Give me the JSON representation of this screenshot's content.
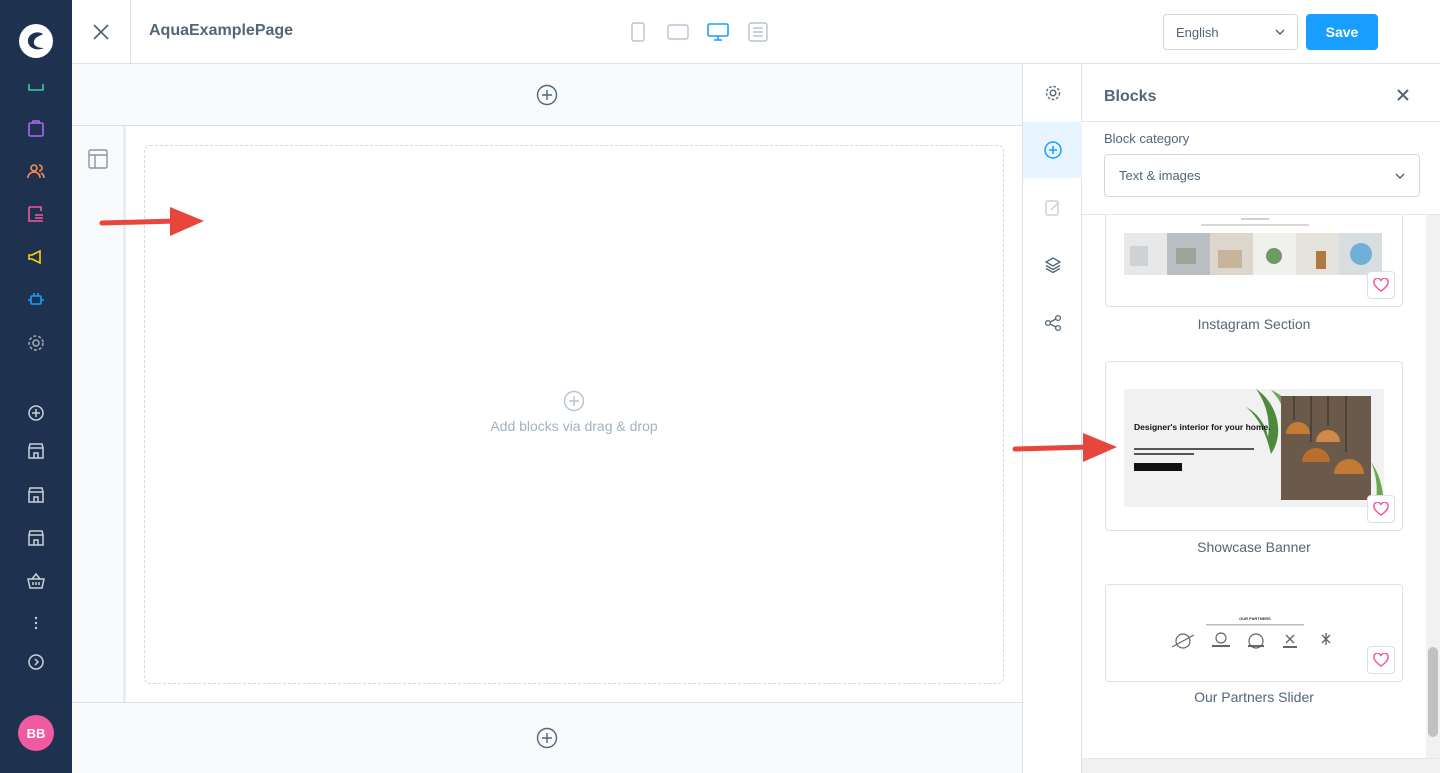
{
  "app": {
    "avatar_initials": "BB",
    "nav_icons": [
      "dashboard-icon",
      "catalog-icon",
      "customers-icon",
      "orders-icon",
      "marketing-icon",
      "extensions-icon",
      "settings-icon",
      "add-icon",
      "sales-channel-icon",
      "sales-channel-icon",
      "sales-channel-icon",
      "basket-icon",
      "more-icon",
      "collapse-icon"
    ]
  },
  "topbar": {
    "title": "AquaExamplePage",
    "language": "English",
    "save_label": "Save",
    "viewports": [
      "mobile",
      "tablet",
      "desktop",
      "form"
    ],
    "active_viewport": "desktop"
  },
  "canvas": {
    "dropzone_text": "Add blocks via drag & drop"
  },
  "blocks_panel": {
    "title": "Blocks",
    "category_label": "Block category",
    "category_value": "Text & images",
    "blocks": [
      {
        "name": "Instagram Section"
      },
      {
        "name": "Showcase Banner",
        "preview_heading": "Designer's interior for your home.",
        "preview_text": "Lorem Ipsum is simply dummy text of the printing and typesetting industry.",
        "preview_button": "View details"
      },
      {
        "name": "Our Partners Slider",
        "preview_heading": "OUR PARTNERS"
      }
    ]
  },
  "colors": {
    "sidebar_bg": "#1e3250",
    "primary": "#189eff",
    "annotation": "#e8453c",
    "favorite": "#f05aa0"
  }
}
